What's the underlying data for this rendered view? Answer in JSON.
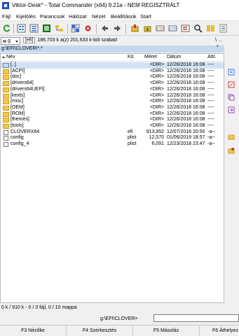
{
  "window": {
    "title": "Viktor-Desk^ - Total Commander (x64) 9.21a - NEM REGISZTRÁLT"
  },
  "menu": {
    "items": [
      "Fájl",
      "Kijelölés",
      "Parancsok",
      "Hálózat",
      "Nézet",
      "Beállítások",
      "Start"
    ]
  },
  "drive": {
    "letter": "g",
    "label": "[efi]",
    "free_text": "186,703 k a(z) 201,633 k-ból szabad",
    "dots": "\\  ..",
    "star": "*"
  },
  "path": {
    "text": "g:\\EFI\\CLOVER\\*.*"
  },
  "columns": {
    "name": "Név",
    "ext": "Kit.",
    "size": "Méret",
    "date": "Dátum",
    "attr": "Attr."
  },
  "files": [
    {
      "name": "[..]",
      "ext": "",
      "size": "<DIR>",
      "date": "12/26/2018 16:08",
      "attr": "----",
      "type": "up"
    },
    {
      "name": "[ACPI]",
      "ext": "",
      "size": "<DIR>",
      "date": "12/26/2018 16:08",
      "attr": "----",
      "type": "folder"
    },
    {
      "name": "[doc]",
      "ext": "",
      "size": "<DIR>",
      "date": "12/26/2018 16:08",
      "attr": "----",
      "type": "folder"
    },
    {
      "name": "[drivers64]",
      "ext": "",
      "size": "<DIR>",
      "date": "12/26/2018 16:08",
      "attr": "----",
      "type": "folder"
    },
    {
      "name": "[drivers64UEFI]",
      "ext": "",
      "size": "<DIR>",
      "date": "12/26/2018 16:08",
      "attr": "----",
      "type": "folder"
    },
    {
      "name": "[kexts]",
      "ext": "",
      "size": "<DIR>",
      "date": "12/26/2018 16:08",
      "attr": "----",
      "type": "folder"
    },
    {
      "name": "[misc]",
      "ext": "",
      "size": "<DIR>",
      "date": "12/26/2018 16:08",
      "attr": "----",
      "type": "folder"
    },
    {
      "name": "[OEM]",
      "ext": "",
      "size": "<DIR>",
      "date": "12/26/2018 16:08",
      "attr": "----",
      "type": "folder"
    },
    {
      "name": "[ROM]",
      "ext": "",
      "size": "<DIR>",
      "date": "12/26/2018 16:08",
      "attr": "----",
      "type": "folder"
    },
    {
      "name": "[themes]",
      "ext": "",
      "size": "<DIR>",
      "date": "12/26/2018 16:08",
      "attr": "----",
      "type": "folder"
    },
    {
      "name": "[tools]",
      "ext": "",
      "size": "<DIR>",
      "date": "12/26/2018 16:08",
      "attr": "----",
      "type": "folder"
    },
    {
      "name": "CLOVERX64",
      "ext": "efi",
      "size": "913,952",
      "date": "12/07/2018 20:50",
      "attr": "-a--",
      "type": "file"
    },
    {
      "name": "config",
      "ext": "plist",
      "size": "12,570",
      "date": "01/06/2019 18:57",
      "attr": "-a--",
      "type": "file"
    },
    {
      "name": "config_4",
      "ext": "plist",
      "size": "6,091",
      "date": "12/23/2018 23:47",
      "attr": "-a--",
      "type": "file"
    }
  ],
  "status": {
    "text": "0 k / 910 k - 0 / 3 fájl, 0 / 10 mappa"
  },
  "command": {
    "label": "g:\\EFI\\CLOVER>",
    "value": ""
  },
  "fkeys": [
    "F3 Nézőke",
    "F4 Szerkesztés",
    "F5 Másolás",
    "F6 Áthelyez"
  ],
  "colors": {
    "selection": "#cfe3f7",
    "path_bar": "#c5d8ee",
    "folder": "#f2c94c"
  }
}
